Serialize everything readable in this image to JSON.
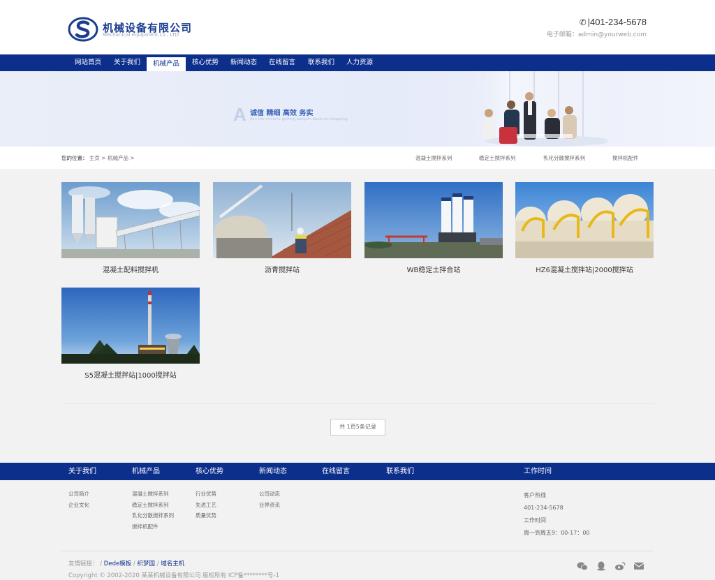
{
  "header": {
    "company_name": "机械设备有限公司",
    "company_en": "Mechanical equipment co., LTD",
    "phone": "401-234-5678",
    "email": "电子邮箱：admin@yourweb.com"
  },
  "nav": [
    {
      "label": "网站首页"
    },
    {
      "label": "关于我们"
    },
    {
      "label": "机械产品",
      "active": true
    },
    {
      "label": "核心优势"
    },
    {
      "label": "新闻动态"
    },
    {
      "label": "在线留言"
    },
    {
      "label": "联系我们"
    },
    {
      "label": "人力资源"
    }
  ],
  "banner": {
    "letter": "A",
    "slogan": "诚信 精细 高效 务实",
    "sub": "Join the millions getting bargain deals on shopping"
  },
  "breadcrumb": {
    "prefix": "您的位置：",
    "home": "主页",
    "sep1": ">",
    "current": "机械产品",
    "sep2": ">"
  },
  "subcats": [
    "混凝土搅拌系列",
    "稳定土搅拌系列",
    "乳化分散搅拌系列",
    "搅拌机配件"
  ],
  "products": [
    {
      "name": "混凝土配料搅拌机"
    },
    {
      "name": "沥青搅拌站"
    },
    {
      "name": "WB稳定土拌合站"
    },
    {
      "name": "HZ6混凝土搅拌站|2000搅拌站"
    },
    {
      "name": "S5混凝土搅拌站|1000搅拌站"
    }
  ],
  "pager": "共 1页5条记录",
  "footer": {
    "nav": [
      "关于我们",
      "机械产品",
      "核心优势",
      "新闻动态",
      "在线留言",
      "联系我们",
      "工作时间"
    ],
    "col_about": [
      "公司简介",
      "企业文化"
    ],
    "col_products": [
      "混凝土搅拌系列",
      "稳定土搅拌系列",
      "乳化分散搅拌系列",
      "搅拌机配件"
    ],
    "col_advantage": [
      "行业优势",
      "先进工艺",
      "质量优势"
    ],
    "col_news": [
      "公司动态",
      "业界资讯"
    ],
    "work": [
      "客户热线",
      "401-234-5678",
      "工作时间",
      "周一到周五9：00-17：00"
    ],
    "links_label": "友情链接：",
    "links": [
      "Dede模板",
      "织梦园",
      "域名主机"
    ],
    "link_sep": "/",
    "copyright": "Copyright © 2002-2020 某某机械设备有限公司 版权所有 ICP备********号-1",
    "social_icons": [
      "wechat-icon",
      "qq-icon",
      "weibo-icon",
      "mail-icon"
    ]
  },
  "colors": {
    "primary": "#0d2f8c",
    "bg": "#f2f2f2"
  }
}
